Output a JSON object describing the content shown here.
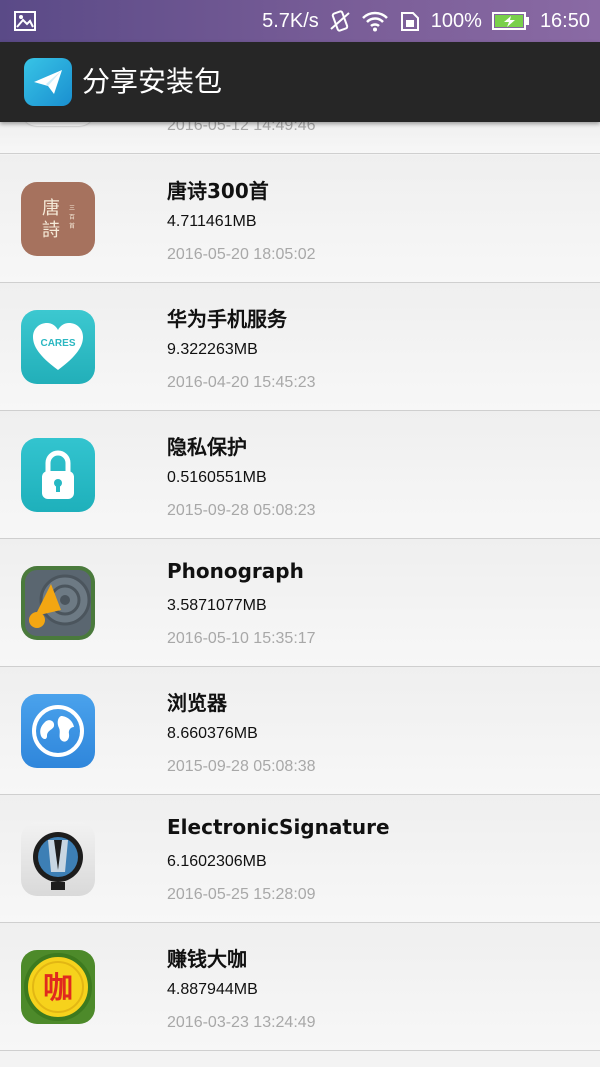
{
  "status_bar": {
    "speed": "5.7K/s",
    "battery_percent": "100%",
    "time": "16:50",
    "icons": [
      "image-icon",
      "vibrate-icon",
      "wifi-icon",
      "sim-icon",
      "battery-charging-icon"
    ]
  },
  "app_bar": {
    "title": "分享安装包",
    "logo_icon": "paper-plane-icon"
  },
  "apps": [
    {
      "name": "",
      "size": "",
      "date": "2016-05-12 14:49:46",
      "icon": "partial-app-icon"
    },
    {
      "name": "唐诗300首",
      "size": "4.711461MB",
      "date": "2016-05-20 18:05:02",
      "icon": "tangshi-icon",
      "icon_text": "唐詩"
    },
    {
      "name": "华为手机服务",
      "size": "9.322263MB",
      "date": "2016-04-20 15:45:23",
      "icon": "cares-heart-icon",
      "icon_text": "CARES"
    },
    {
      "name": "隐私保护",
      "size": "0.5160551MB",
      "date": "2015-09-28 05:08:23",
      "icon": "padlock-icon"
    },
    {
      "name": "Phonograph",
      "size": "3.5871077MB",
      "date": "2016-05-10 15:35:17",
      "icon": "phonograph-icon"
    },
    {
      "name": "浏览器",
      "size": "8.660376MB",
      "date": "2015-09-28 05:08:38",
      "icon": "globe-icon"
    },
    {
      "name": "ElectronicSignature",
      "size": "6.1602306MB",
      "date": "2016-05-25 15:28:09",
      "icon": "signature-icon"
    },
    {
      "name": "赚钱大咖",
      "size": "4.887944MB",
      "date": "2016-03-23 13:24:49",
      "icon": "kaka-icon",
      "icon_text": "咖"
    }
  ],
  "colors": {
    "status_bar": "#6a5590",
    "app_bar": "#262626",
    "date_text": "#a8a8a8",
    "divider": "#cfcfcf"
  }
}
